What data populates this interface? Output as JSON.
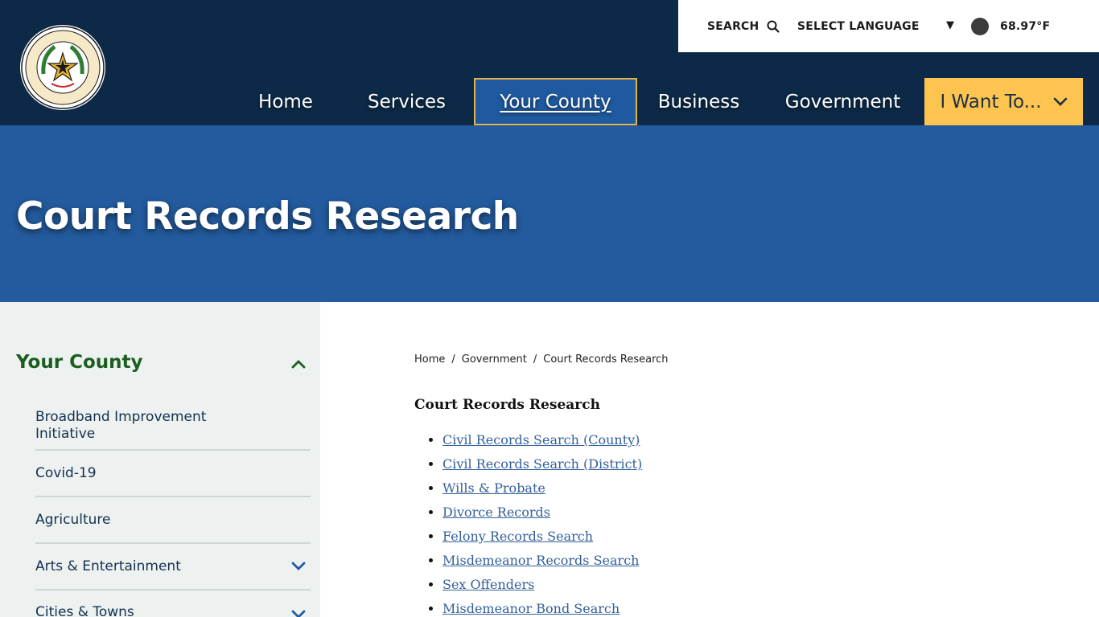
{
  "header": {
    "seal_text": "THE STATE OF TEXAS · FORT BEND COUNTY",
    "utility": {
      "search_label": "SEARCH",
      "language_label": "SELECT LANGUAGE",
      "temperature": "68.97°F"
    },
    "nav": [
      {
        "label": "Home"
      },
      {
        "label": "Services"
      },
      {
        "label": "Your County"
      },
      {
        "label": "Business"
      },
      {
        "label": "Government"
      },
      {
        "label": "I Want To..."
      }
    ]
  },
  "banner": {
    "title": "Court Records Research"
  },
  "sidebar": {
    "heading": "Your County",
    "items": [
      {
        "label": "Broadband Improvement Initiative"
      },
      {
        "label": "Covid-19"
      },
      {
        "label": "Agriculture"
      },
      {
        "label": "Arts & Entertainment"
      },
      {
        "label": "Cities & Towns"
      }
    ]
  },
  "breadcrumb": {
    "items": [
      "Home",
      "Government",
      "Court Records Research"
    ],
    "separator": "/"
  },
  "content": {
    "title": "Court Records Research",
    "links": [
      "Civil Records Search (County)",
      "Civil Records Search (District)",
      "Wills & Probate",
      "Divorce Records",
      "Felony Records Search",
      "Misdemeanor Records Search",
      "Sex Offenders",
      "Misdemeanor Bond Search"
    ]
  },
  "colors": {
    "header_bg": "#0c2a47",
    "banner_bg": "#235b9e",
    "accent_yellow": "#fdc44f",
    "sidebar_bg": "#edf1f0",
    "sidebar_heading": "#1b5e20",
    "link": "#33609a"
  },
  "icons": {
    "search": "search-icon",
    "language_caret": "caret-down-icon",
    "weather": "weather-icon",
    "want_chevron": "chevron-down-icon",
    "sidebar_collapse": "chevron-up-icon",
    "sidebar_expand": "chevron-down-icon"
  }
}
